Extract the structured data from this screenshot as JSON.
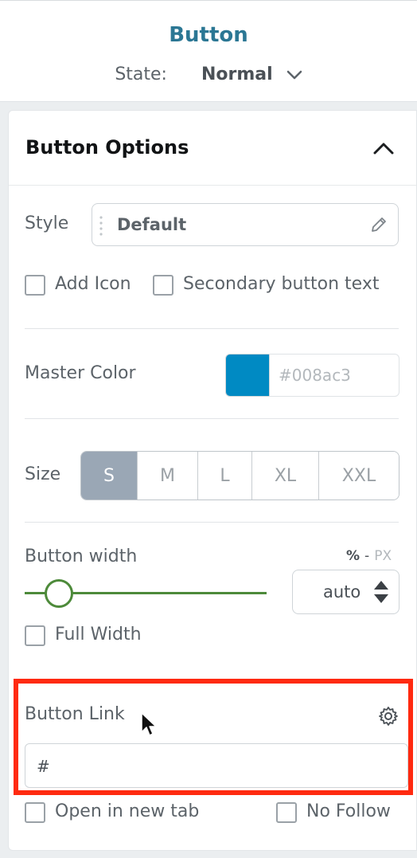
{
  "header": {
    "title": "Button",
    "state_label": "State:",
    "state_value": "Normal"
  },
  "panel": {
    "title": "Button Options",
    "style": {
      "label": "Style",
      "value": "Default"
    },
    "checkboxes": {
      "add_icon": "Add Icon",
      "secondary_text": "Secondary button text"
    },
    "master_color": {
      "label": "Master Color",
      "value": "#008ac3",
      "placeholder": "#008ac3"
    },
    "size": {
      "label": "Size",
      "options": [
        "S",
        "M",
        "L",
        "XL",
        "XXL"
      ],
      "selected": "S"
    },
    "button_width": {
      "label": "Button width",
      "unit_percent": "%",
      "unit_separator": "-",
      "unit_px": "PX",
      "value": "auto",
      "full_width_label": "Full Width"
    },
    "button_link": {
      "label": "Button Link",
      "value": "#",
      "open_new_tab_label": "Open in new tab",
      "no_follow_label": "No Follow"
    }
  },
  "colors": {
    "accent_title": "#2b7794",
    "master_color": "#008ac3",
    "slider": "#4d8a3a",
    "size_active": "#9aa7b5",
    "highlight": "#ff2a10"
  },
  "icons": {
    "state_dropdown": "chevron-down-icon",
    "collapse": "chevron-up-icon",
    "style_drag": "drag-dots-icon",
    "style_edit": "pencil-icon",
    "width_spinner": "spinner-arrows-icon",
    "link_settings": "gear-icon",
    "cursor": "mouse-pointer-icon"
  }
}
